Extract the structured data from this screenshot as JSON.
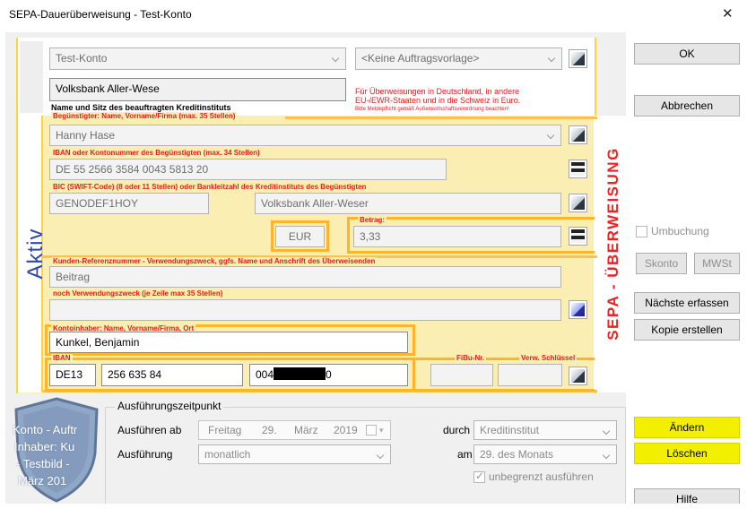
{
  "window": {
    "title": "SEPA-Dauerüberweisung - Test-Konto",
    "close_glyph": "✕"
  },
  "form": {
    "account_combo": "Test-Konto",
    "template_combo": "<Keine Auftragsvorlage>",
    "bank_name": "Volksbank Aller-Wese",
    "bank_caption": "Name und Sitz des beauftragten Kreditinstituts",
    "info_line1": "Für Überweisungen in Deutschland, in andere",
    "info_line2": "EU-/EWR-Staaten und in die Schweiz in Euro.",
    "info_line3": "Bitte Meldepflicht gemäß Außenwirtschaftsverordnung beachten!",
    "beneficiary_label": "Begünstigter: Name, Vorname/Firma (max. 35 Stellen)",
    "beneficiary_name": "Hanny Hase",
    "iban_label": "IBAN oder Kontonummer des Begünstigten (max. 34 Stellen)",
    "iban_value": "DE 55 2566 3584 0043 5813 20",
    "bic_label": "BIC (SWIFT-Code) (8 oder 11 Stellen) oder Bankleitzahl des Kreditinstituts des Begünstigten",
    "bic_value": "GENODEF1HOY",
    "beneficiary_bank": "Volksbank Aller-Weser",
    "currency": "EUR",
    "amount_label": "Betrag:",
    "amount_value": "3,33",
    "reference_label": "Kunden-Referenznummer - Verwendungszweck, ggfs. Name und Anschrift des Überweisenden",
    "reference_value": "Beitrag",
    "purpose2_label": "noch Verwendungszweck (je Zeile max 35 Stellen)",
    "purpose2_value": "",
    "holder_label": "Kontoinhaber: Name, Vorname/Firma, Ort",
    "holder_value": "Kunkel, Benjamin",
    "holder_iban_label": "IBAN",
    "holder_iban_country": "DE13",
    "holder_iban_blz": "256 635 84",
    "holder_iban_acct_prefix": "004",
    "holder_iban_acct_suffix": "0",
    "fibu_label": "FiBu-Nr.",
    "schluessel_label": "Verw. Schlüssel",
    "aktiv_label": "Aktiv",
    "sepa_label": "SEPA - ÜBERWEISUNG"
  },
  "buttons": {
    "ok": "OK",
    "abbrechen": "Abbrechen",
    "umbuchung": "Umbuchung",
    "skonto": "Skonto",
    "mwst": "MWSt",
    "naechste": "Nächste erfassen",
    "kopie": "Kopie erstellen",
    "aendern": "Ändern",
    "loeschen": "Löschen",
    "hilfe": "Hilfe"
  },
  "schedule": {
    "group_title": "Ausführungszeitpunkt",
    "ab_label": "Ausführen ab",
    "weekday": "Freitag",
    "day": "29.",
    "month": "März",
    "year": "2019",
    "mode_label": "Ausführung",
    "mode_value": "monatlich",
    "durch_label": "durch",
    "durch_value": "Kreditinstitut",
    "am_label": "am",
    "am_value": "29. des Monats",
    "unbegrenzt_label": "unbegrenzt ausführen"
  },
  "watermark": {
    "line1": "Konto - Auftr",
    "line2": "Inhaber: Ku",
    "line3": "- Testbild -",
    "line4": "März 201"
  },
  "colors": {
    "form_yellow": "#fbeeb3",
    "frame_orange": "#ffb52b",
    "label_red": "#e0201e",
    "aktiv_blue": "#3148a8",
    "highlight_yellow": "#f2f000"
  }
}
